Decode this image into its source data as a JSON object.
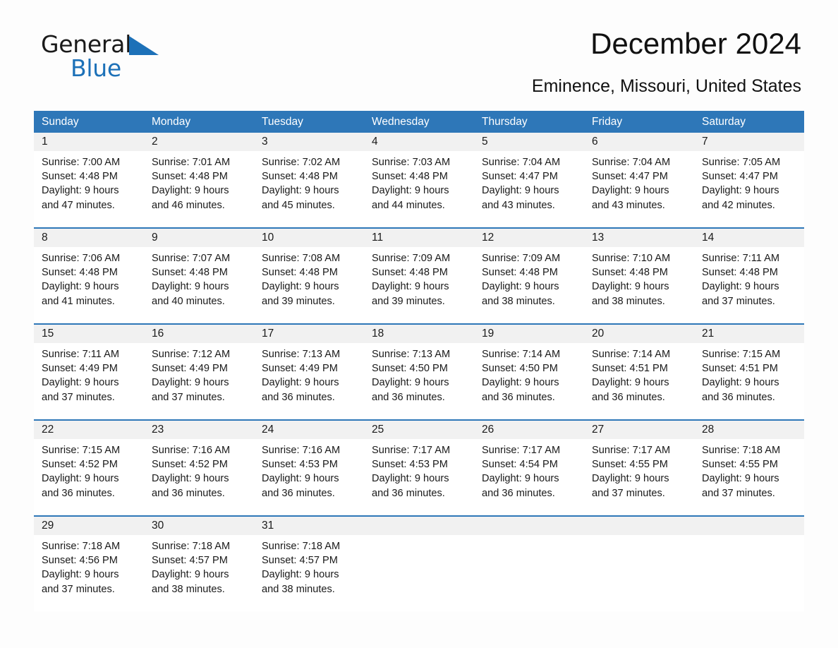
{
  "brand": {
    "name_part1": "General",
    "name_part2": "Blue",
    "triangle_color": "#1d71b8"
  },
  "header": {
    "title": "December 2024",
    "subtitle": "Eminence, Missouri, United States"
  },
  "calendar": {
    "header_bg": "#2e77b8",
    "daynum_band_bg": "#f1f1f1",
    "weekdays": [
      "Sunday",
      "Monday",
      "Tuesday",
      "Wednesday",
      "Thursday",
      "Friday",
      "Saturday"
    ],
    "weeks": [
      [
        {
          "day": "1",
          "lines": [
            "Sunrise: 7:00 AM",
            "Sunset: 4:48 PM",
            "Daylight: 9 hours",
            "and 47 minutes."
          ]
        },
        {
          "day": "2",
          "lines": [
            "Sunrise: 7:01 AM",
            "Sunset: 4:48 PM",
            "Daylight: 9 hours",
            "and 46 minutes."
          ]
        },
        {
          "day": "3",
          "lines": [
            "Sunrise: 7:02 AM",
            "Sunset: 4:48 PM",
            "Daylight: 9 hours",
            "and 45 minutes."
          ]
        },
        {
          "day": "4",
          "lines": [
            "Sunrise: 7:03 AM",
            "Sunset: 4:48 PM",
            "Daylight: 9 hours",
            "and 44 minutes."
          ]
        },
        {
          "day": "5",
          "lines": [
            "Sunrise: 7:04 AM",
            "Sunset: 4:47 PM",
            "Daylight: 9 hours",
            "and 43 minutes."
          ]
        },
        {
          "day": "6",
          "lines": [
            "Sunrise: 7:04 AM",
            "Sunset: 4:47 PM",
            "Daylight: 9 hours",
            "and 43 minutes."
          ]
        },
        {
          "day": "7",
          "lines": [
            "Sunrise: 7:05 AM",
            "Sunset: 4:47 PM",
            "Daylight: 9 hours",
            "and 42 minutes."
          ]
        }
      ],
      [
        {
          "day": "8",
          "lines": [
            "Sunrise: 7:06 AM",
            "Sunset: 4:48 PM",
            "Daylight: 9 hours",
            "and 41 minutes."
          ]
        },
        {
          "day": "9",
          "lines": [
            "Sunrise: 7:07 AM",
            "Sunset: 4:48 PM",
            "Daylight: 9 hours",
            "and 40 minutes."
          ]
        },
        {
          "day": "10",
          "lines": [
            "Sunrise: 7:08 AM",
            "Sunset: 4:48 PM",
            "Daylight: 9 hours",
            "and 39 minutes."
          ]
        },
        {
          "day": "11",
          "lines": [
            "Sunrise: 7:09 AM",
            "Sunset: 4:48 PM",
            "Daylight: 9 hours",
            "and 39 minutes."
          ]
        },
        {
          "day": "12",
          "lines": [
            "Sunrise: 7:09 AM",
            "Sunset: 4:48 PM",
            "Daylight: 9 hours",
            "and 38 minutes."
          ]
        },
        {
          "day": "13",
          "lines": [
            "Sunrise: 7:10 AM",
            "Sunset: 4:48 PM",
            "Daylight: 9 hours",
            "and 38 minutes."
          ]
        },
        {
          "day": "14",
          "lines": [
            "Sunrise: 7:11 AM",
            "Sunset: 4:48 PM",
            "Daylight: 9 hours",
            "and 37 minutes."
          ]
        }
      ],
      [
        {
          "day": "15",
          "lines": [
            "Sunrise: 7:11 AM",
            "Sunset: 4:49 PM",
            "Daylight: 9 hours",
            "and 37 minutes."
          ]
        },
        {
          "day": "16",
          "lines": [
            "Sunrise: 7:12 AM",
            "Sunset: 4:49 PM",
            "Daylight: 9 hours",
            "and 37 minutes."
          ]
        },
        {
          "day": "17",
          "lines": [
            "Sunrise: 7:13 AM",
            "Sunset: 4:49 PM",
            "Daylight: 9 hours",
            "and 36 minutes."
          ]
        },
        {
          "day": "18",
          "lines": [
            "Sunrise: 7:13 AM",
            "Sunset: 4:50 PM",
            "Daylight: 9 hours",
            "and 36 minutes."
          ]
        },
        {
          "day": "19",
          "lines": [
            "Sunrise: 7:14 AM",
            "Sunset: 4:50 PM",
            "Daylight: 9 hours",
            "and 36 minutes."
          ]
        },
        {
          "day": "20",
          "lines": [
            "Sunrise: 7:14 AM",
            "Sunset: 4:51 PM",
            "Daylight: 9 hours",
            "and 36 minutes."
          ]
        },
        {
          "day": "21",
          "lines": [
            "Sunrise: 7:15 AM",
            "Sunset: 4:51 PM",
            "Daylight: 9 hours",
            "and 36 minutes."
          ]
        }
      ],
      [
        {
          "day": "22",
          "lines": [
            "Sunrise: 7:15 AM",
            "Sunset: 4:52 PM",
            "Daylight: 9 hours",
            "and 36 minutes."
          ]
        },
        {
          "day": "23",
          "lines": [
            "Sunrise: 7:16 AM",
            "Sunset: 4:52 PM",
            "Daylight: 9 hours",
            "and 36 minutes."
          ]
        },
        {
          "day": "24",
          "lines": [
            "Sunrise: 7:16 AM",
            "Sunset: 4:53 PM",
            "Daylight: 9 hours",
            "and 36 minutes."
          ]
        },
        {
          "day": "25",
          "lines": [
            "Sunrise: 7:17 AM",
            "Sunset: 4:53 PM",
            "Daylight: 9 hours",
            "and 36 minutes."
          ]
        },
        {
          "day": "26",
          "lines": [
            "Sunrise: 7:17 AM",
            "Sunset: 4:54 PM",
            "Daylight: 9 hours",
            "and 36 minutes."
          ]
        },
        {
          "day": "27",
          "lines": [
            "Sunrise: 7:17 AM",
            "Sunset: 4:55 PM",
            "Daylight: 9 hours",
            "and 37 minutes."
          ]
        },
        {
          "day": "28",
          "lines": [
            "Sunrise: 7:18 AM",
            "Sunset: 4:55 PM",
            "Daylight: 9 hours",
            "and 37 minutes."
          ]
        }
      ],
      [
        {
          "day": "29",
          "lines": [
            "Sunrise: 7:18 AM",
            "Sunset: 4:56 PM",
            "Daylight: 9 hours",
            "and 37 minutes."
          ]
        },
        {
          "day": "30",
          "lines": [
            "Sunrise: 7:18 AM",
            "Sunset: 4:57 PM",
            "Daylight: 9 hours",
            "and 38 minutes."
          ]
        },
        {
          "day": "31",
          "lines": [
            "Sunrise: 7:18 AM",
            "Sunset: 4:57 PM",
            "Daylight: 9 hours",
            "and 38 minutes."
          ]
        },
        {
          "day": "",
          "lines": []
        },
        {
          "day": "",
          "lines": []
        },
        {
          "day": "",
          "lines": []
        },
        {
          "day": "",
          "lines": []
        }
      ]
    ]
  }
}
